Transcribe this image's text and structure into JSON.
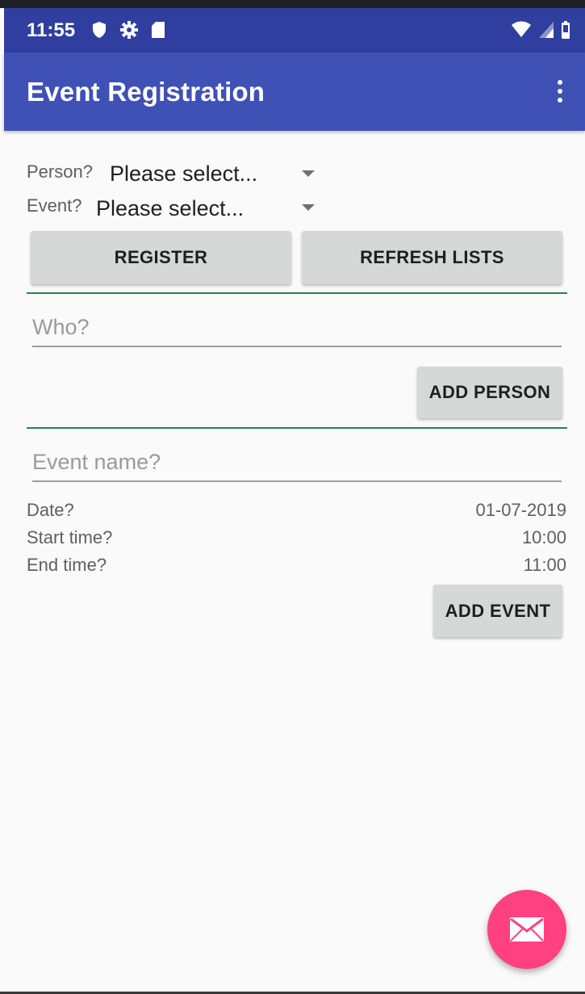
{
  "status_bar": {
    "time": "11:55",
    "icons_left": [
      "shield-icon",
      "settings-icon",
      "sd-card-icon"
    ],
    "icons_right": [
      "wifi-icon",
      "signal-icon",
      "battery-icon"
    ]
  },
  "app_bar": {
    "title": "Event Registration",
    "menu_icon": "overflow-menu-icon",
    "background": "#3f51b5",
    "status_background": "#303f9f"
  },
  "registration": {
    "person_label": "Person?",
    "person_value": "Please select...",
    "event_label": "Event?",
    "event_value": "Please select...",
    "register_button": "REGISTER",
    "refresh_button": "REFRESH LISTS"
  },
  "add_person": {
    "who_placeholder": "Who?",
    "who_value": "",
    "button": "ADD PERSON"
  },
  "add_event": {
    "name_placeholder": "Event name?",
    "name_value": "",
    "date_label": "Date?",
    "date_value": "01-07-2019",
    "start_label": "Start time?",
    "start_value": "10:00",
    "end_label": "End time?",
    "end_value": "11:00",
    "button": "ADD EVENT"
  },
  "fab": {
    "icon": "mail-icon",
    "color": "#ff4081"
  },
  "divider_color": "#2e7d4f"
}
